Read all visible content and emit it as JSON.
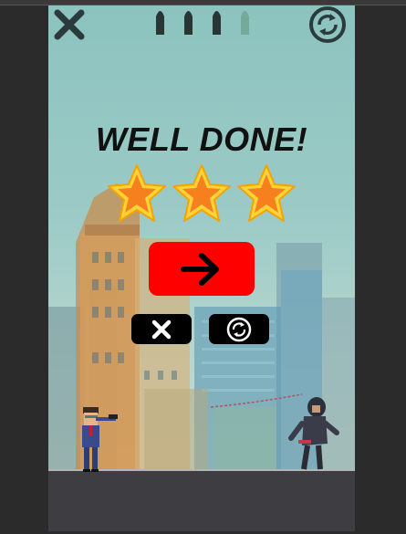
{
  "hud": {
    "close_icon": "x-icon",
    "restart_icon": "restart-icon",
    "bullets_total": 4,
    "bullets_remaining": 3
  },
  "result": {
    "title": "WELL DONE!",
    "stars_earned": 3,
    "stars_total": 3
  },
  "buttons": {
    "next_icon": "arrow-right-icon",
    "menu_icon": "x-icon",
    "retry_icon": "restart-icon"
  },
  "colors": {
    "next_button": "#ff0000",
    "secondary_buttons": "#000000",
    "star_fill": "#f79a1c",
    "star_rim": "#ffd23c"
  }
}
